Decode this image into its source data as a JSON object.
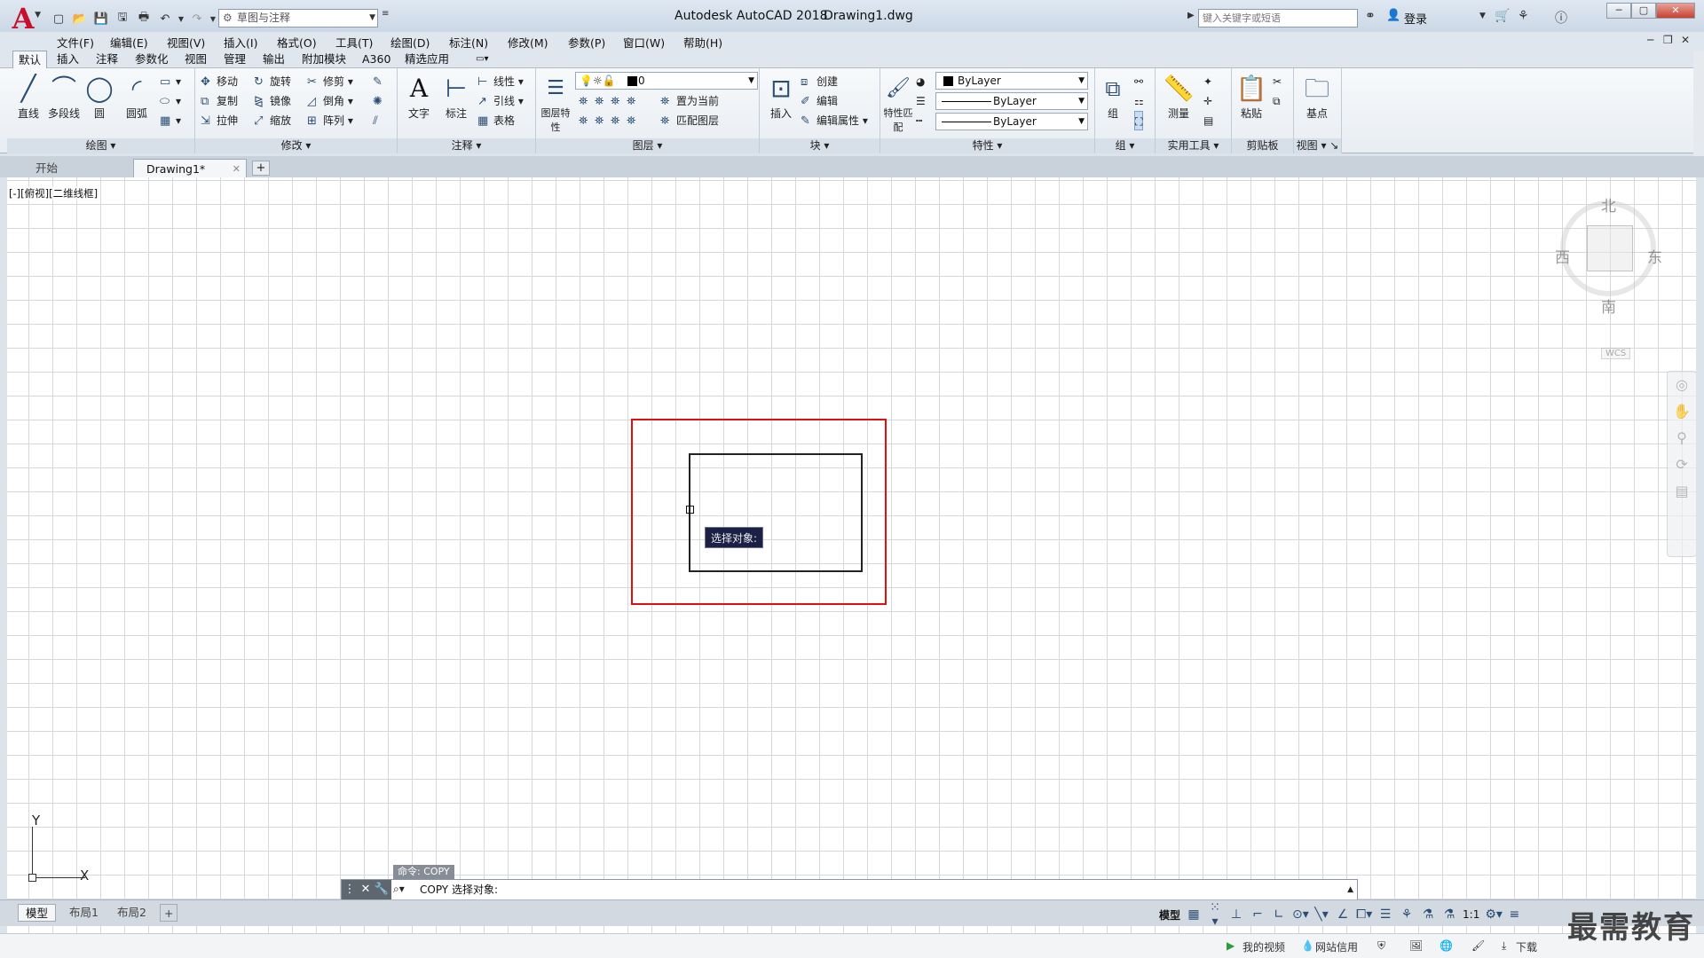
{
  "title": {
    "app": "Autodesk AutoCAD 2018",
    "file": "Drawing1.dwg",
    "workspace": "草图与注释",
    "search_placeholder": "键入关键字或短语",
    "login": "登录"
  },
  "menu": [
    "文件(F)",
    "编辑(E)",
    "视图(V)",
    "插入(I)",
    "格式(O)",
    "工具(T)",
    "绘图(D)",
    "标注(N)",
    "修改(M)",
    "参数(P)",
    "窗口(W)",
    "帮助(H)"
  ],
  "ribbon_tabs": [
    "默认",
    "插入",
    "注释",
    "参数化",
    "视图",
    "管理",
    "输出",
    "附加模块",
    "A360",
    "精选应用"
  ],
  "ribbon": {
    "draw": {
      "title": "绘图",
      "line": "直线",
      "polyline": "多段线",
      "circle": "圆",
      "arc": "圆弧"
    },
    "modify": {
      "title": "修改",
      "move": "移动",
      "rotate": "旋转",
      "trim": "修剪",
      "copy": "复制",
      "mirror": "镜像",
      "fillet": "倒角",
      "stretch": "拉伸",
      "scale": "缩放",
      "array": "阵列"
    },
    "annotation": {
      "title": "注释",
      "text": "文字",
      "dimension": "标注",
      "linear": "线性",
      "leader": "引线",
      "table": "表格"
    },
    "layers": {
      "title": "图层",
      "layer_props": "图层特性",
      "layer_name": "0",
      "set_current": "置为当前",
      "match_layer": "匹配图层"
    },
    "block": {
      "title": "块",
      "insert": "插入",
      "create": "创建",
      "edit": "编辑",
      "edit_attr": "编辑属性"
    },
    "properties": {
      "title": "特性",
      "match": "特性匹配",
      "color": "ByLayer",
      "linetype": "ByLayer",
      "lineweight": "ByLayer"
    },
    "groups": {
      "title": "组",
      "group": "组"
    },
    "utilities": {
      "title": "实用工具",
      "measure": "测量"
    },
    "clipboard": {
      "title": "剪贴板",
      "paste": "粘贴"
    },
    "view": {
      "title": "视图",
      "base": "基点"
    }
  },
  "doc_tabs": {
    "start": "开始",
    "drawing": "Drawing1*"
  },
  "viewport_label": "[-][俯视][二维线框]",
  "viewcube": {
    "north": "北",
    "south": "南",
    "east": "东",
    "west": "西",
    "wcs": "WCS"
  },
  "ucs": {
    "x": "X",
    "y": "Y"
  },
  "tooltip": "选择对象:",
  "command": {
    "history": "命令: COPY",
    "current": "COPY 选择对象:"
  },
  "layout_tabs": [
    "模型",
    "布局1",
    "布局2"
  ],
  "status": {
    "model": "模型",
    "scale": "1:1"
  },
  "bottom": {
    "my_video": "我的视频",
    "net_credit": "网站信用",
    "download": "下载"
  },
  "watermark": "最需教育",
  "colors": {
    "selection": "#e01010",
    "tooltip_bg": "#1c2143",
    "logo": "#c8102e"
  }
}
